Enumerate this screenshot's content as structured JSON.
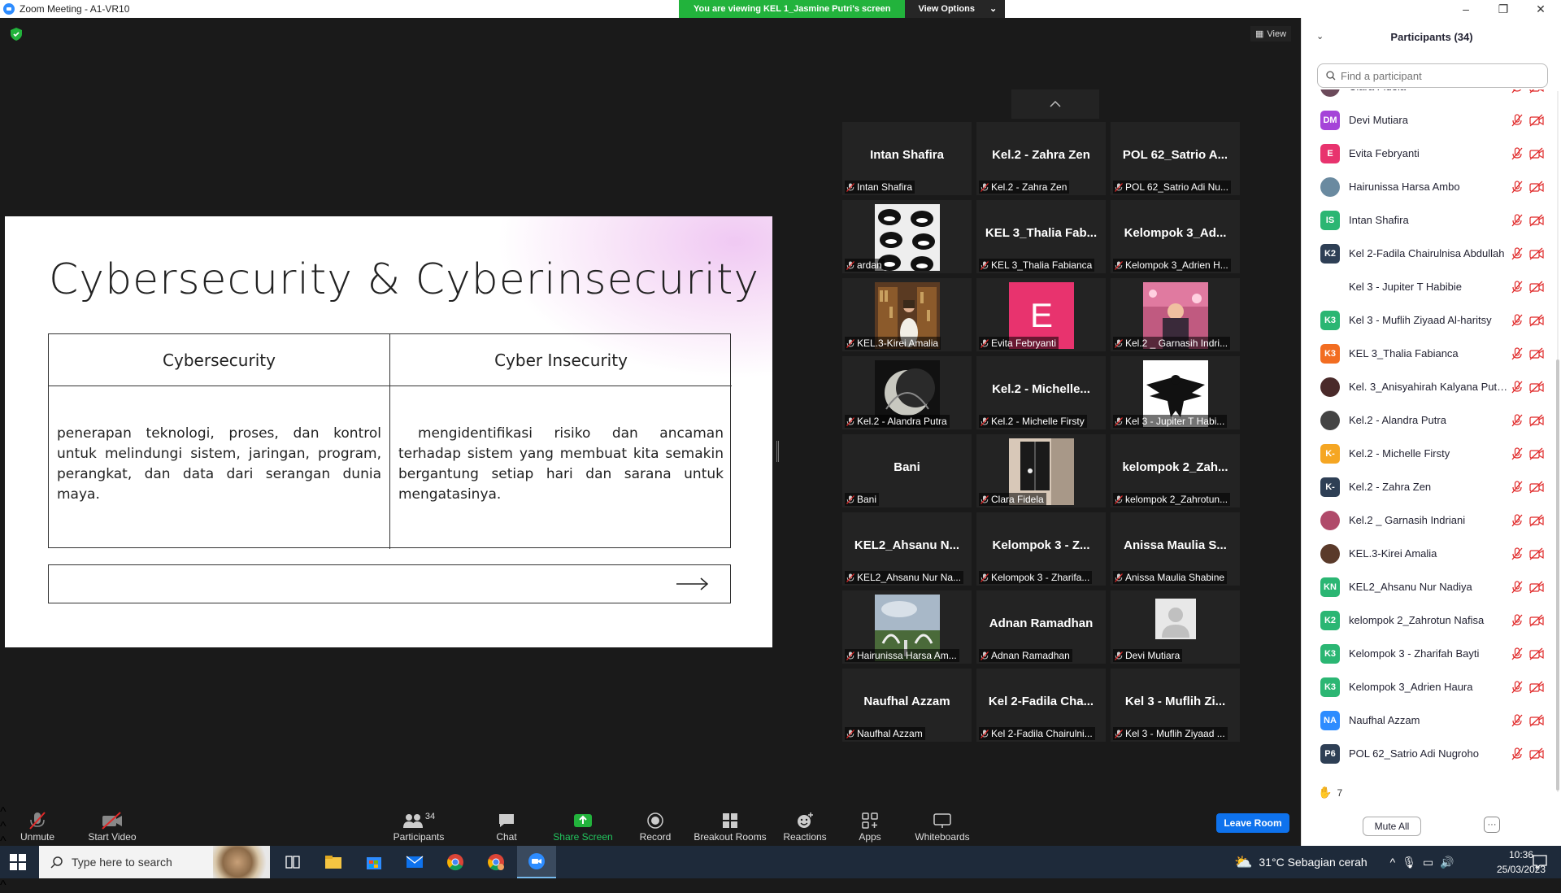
{
  "window": {
    "title": "Zoom Meeting - A1-VR10",
    "viewing_banner": "You are viewing KEL 1_Jasmine Putri's screen",
    "view_options": "View Options",
    "view_label": "View"
  },
  "slide": {
    "title": "Cybersecurity & Cyberinsecurity",
    "col1_header": "Cybersecurity",
    "col2_header": "Cyber Insecurity",
    "col1_body": "penerapan teknologi, proses, dan kontrol untuk melindungi sistem, jaringan, program, perangkat, dan data dari serangan dunia maya.",
    "col2_body": "mengidentifikasi risiko dan ancaman terhadap sistem yang membuat kita semakin bergantung setiap hari dan sarana untuk mengatasinya."
  },
  "gallery": [
    {
      "big": "Intan Shafira",
      "label": "Intan Shafira",
      "pic": null
    },
    {
      "big": "Kel.2 - Zahra Zen",
      "label": "Kel.2 - Zahra Zen",
      "pic": null
    },
    {
      "big": "POL 62_Satrio A...",
      "label": "POL 62_Satrio Adi Nu...",
      "pic": null
    },
    {
      "big": "",
      "label": "ardan",
      "pic": "tongue"
    },
    {
      "big": "KEL 3_Thalia Fab...",
      "label": "KEL 3_Thalia Fabianca",
      "pic": null
    },
    {
      "big": "Kelompok 3_Ad...",
      "label": "Kelompok 3_Adrien H...",
      "pic": null
    },
    {
      "big": "",
      "label": "KEL.3-Kirei Amalia",
      "pic": "library"
    },
    {
      "big": "",
      "label": "Evita Febryanti",
      "pic": "E"
    },
    {
      "big": "",
      "label": "Kel.2 _ Garnasih Indri...",
      "pic": "pink"
    },
    {
      "big": "",
      "label": "Kel.2 - Alandra Putra",
      "pic": "moon"
    },
    {
      "big": "Kel.2 - Michelle...",
      "label": "Kel.2 - Michelle Firsty",
      "pic": null
    },
    {
      "big": "",
      "label": "Kel 3 - Jupiter T Habi...",
      "pic": "eagle"
    },
    {
      "big": "Bani",
      "label": "Bani",
      "pic": null
    },
    {
      "big": "",
      "label": "Clara Fidela",
      "pic": "window"
    },
    {
      "big": "kelompok 2_Zah...",
      "label": "kelompok 2_Zahrotun...",
      "pic": null
    },
    {
      "big": "KEL2_Ahsanu N...",
      "label": "KEL2_Ahsanu Nur Na...",
      "pic": null
    },
    {
      "big": "Kelompok 3 - Z...",
      "label": "Kelompok 3 - Zharifa...",
      "pic": null
    },
    {
      "big": "Anissa Maulia S...",
      "label": "Anissa Maulia Shabine",
      "pic": null
    },
    {
      "big": "",
      "label": "Hairunissa Harsa Am...",
      "pic": "landscape"
    },
    {
      "big": "Adnan Ramadhan",
      "label": "Adnan Ramadhan",
      "pic": null
    },
    {
      "big": "",
      "label": "Devi Mutiara",
      "pic": "default"
    },
    {
      "big": "Naufhal Azzam",
      "label": "Naufhal Azzam",
      "pic": null
    },
    {
      "big": "Kel 2-Fadila Cha...",
      "label": "Kel 2-Fadila Chairulni...",
      "pic": null
    },
    {
      "big": "Kel 3 - Muflih Zi...",
      "label": "Kel 3 - Muflih Ziyaad ...",
      "pic": null
    }
  ],
  "panel": {
    "title": "Participants (34)",
    "find_placeholder": "Find a participant",
    "participants": [
      {
        "initials": "",
        "name": "Clara Fidela",
        "color": "#6b4a5a",
        "photo": true
      },
      {
        "initials": "DM",
        "name": "Devi Mutiara",
        "color": "#a544d8"
      },
      {
        "initials": "E",
        "name": "Evita Febryanti",
        "color": "#e8336e"
      },
      {
        "initials": "",
        "name": "Hairunissa Harsa Ambo",
        "color": "#6a8aa0",
        "photo": true
      },
      {
        "initials": "IS",
        "name": "Intan Shafira",
        "color": "#2bb673"
      },
      {
        "initials": "K2",
        "name": "Kel 2-Fadila Chairulnisa Abdullah",
        "color": "#2e3f55"
      },
      {
        "initials": "",
        "name": "Kel 3 - Jupiter T Habibie",
        "color": "#ffffff",
        "photo": true
      },
      {
        "initials": "K3",
        "name": "Kel 3 - Muflih Ziyaad Al-haritsy",
        "color": "#2bb673"
      },
      {
        "initials": "K3",
        "name": "KEL 3_Thalia Fabianca",
        "color": "#f26d21"
      },
      {
        "initials": "",
        "name": "Kel. 3_Anisyahirah Kalyana Putri...",
        "color": "#4a2a2a",
        "photo": true
      },
      {
        "initials": "",
        "name": "Kel.2 - Alandra Putra",
        "color": "#444444",
        "photo": true
      },
      {
        "initials": "K-",
        "name": "Kel.2 - Michelle Firsty",
        "color": "#f5a623"
      },
      {
        "initials": "K-",
        "name": "Kel.2 - Zahra Zen",
        "color": "#2e3f55"
      },
      {
        "initials": "",
        "name": "Kel.2 _ Garnasih Indriani",
        "color": "#b04a6a",
        "photo": true
      },
      {
        "initials": "",
        "name": "KEL.3-Kirei Amalia",
        "color": "#5a3a2a",
        "photo": true
      },
      {
        "initials": "KN",
        "name": "KEL2_Ahsanu Nur Nadiya",
        "color": "#2bb673"
      },
      {
        "initials": "K2",
        "name": "kelompok 2_Zahrotun Nafisa",
        "color": "#2bb673"
      },
      {
        "initials": "K3",
        "name": "Kelompok 3 - Zharifah Bayti",
        "color": "#2bb673"
      },
      {
        "initials": "K3",
        "name": "Kelompok 3_Adrien Haura",
        "color": "#2bb673"
      },
      {
        "initials": "NA",
        "name": "Naufhal Azzam",
        "color": "#2d8cff"
      },
      {
        "initials": "P6",
        "name": "POL 62_Satrio Adi Nugroho",
        "color": "#2e3f55"
      }
    ],
    "raised_hands": "7",
    "mute_all": "Mute All",
    "more": "···"
  },
  "toolbar": {
    "unmute": "Unmute",
    "start_video": "Start Video",
    "participants": "Participants",
    "participants_count": "34",
    "chat": "Chat",
    "share_screen": "Share Screen",
    "record": "Record",
    "breakout": "Breakout Rooms",
    "reactions": "Reactions",
    "apps": "Apps",
    "whiteboards": "Whiteboards",
    "leave": "Leave Room"
  },
  "taskbar": {
    "search_placeholder": "Type here to search",
    "weather": "31°C  Sebagian cerah",
    "time": "10:36",
    "date": "25/03/2023"
  }
}
